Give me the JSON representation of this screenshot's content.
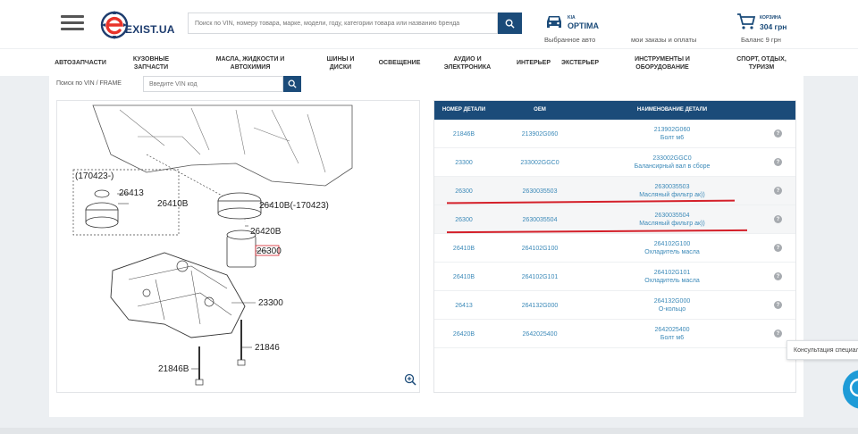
{
  "header": {
    "logo_text": "EXIST.UA",
    "search_placeholder": "Поиск по VIN, номеру товара, марке, модели, году, категории товара или названию бренда",
    "car_brand": "KIA",
    "car_model": "OPTIMA",
    "car_label": "Выбранное авто",
    "orders_label": "мои заказы и оплаты",
    "cart_title": "КОРЗИНА",
    "cart_amount": "304 грн",
    "balance": "Баланс 9 грн"
  },
  "nav": [
    {
      "label": "АВТОЗАПЧАСТИ"
    },
    {
      "label": "КУЗОВНЫЕ ЗАПЧАСТИ"
    },
    {
      "label": "МАСЛА, ЖИДКОСТИ И АВТОХИМИЯ"
    },
    {
      "label": "ШИНЫ И ДИСКИ"
    },
    {
      "label": "ОСВЕЩЕНИЕ"
    },
    {
      "label": "АУДИО И ЭЛЕКТРОНИКА"
    },
    {
      "label": "ИНТЕРЬЕР"
    },
    {
      "label": "ЭКСТЕРЬЕР"
    },
    {
      "label": "ИНСТРУМЕНТЫ И ОБОРУДОВАНИЕ"
    },
    {
      "label": "СПОРТ, ОТДЫХ, ТУРИЗМ"
    }
  ],
  "vin": {
    "label": "Поиск по VIN / FRAME",
    "placeholder": "Введите VIN код"
  },
  "diagram": {
    "labels": [
      "(170423-)",
      "26413",
      "26410B",
      "26410B(-170423)",
      "26420B",
      "26300",
      "23300",
      "21846",
      "21846B"
    ]
  },
  "table": {
    "headers": {
      "number": "НОМЕР ДЕТАЛИ",
      "oem": "OEM",
      "name": "НАИМЕНОВАНИЕ ДЕТАЛИ"
    },
    "help_glyph": "?",
    "rows": [
      {
        "number": "21846B",
        "oem": "213902G060",
        "code": "213902G060",
        "desc": "Болт м6"
      },
      {
        "number": "23300",
        "oem": "233002GGC0",
        "code": "233002GGC0",
        "desc": "Балансирный вал в сборе"
      },
      {
        "number": "26300",
        "oem": "2630035503",
        "code": "2630035503",
        "desc": "Масляный фильтр ак))"
      },
      {
        "number": "26300",
        "oem": "2630035504",
        "code": "2630035504",
        "desc": "Масляный фильтр ак))"
      },
      {
        "number": "26410B",
        "oem": "264102G100",
        "code": "264102G100",
        "desc": "Охладитель масла"
      },
      {
        "number": "26410B",
        "oem": "264102G101",
        "code": "264102G101",
        "desc": "Охладитель масла"
      },
      {
        "number": "26413",
        "oem": "264132G000",
        "code": "264132G000",
        "desc": "О-кольцо"
      },
      {
        "number": "26420B",
        "oem": "2642025400",
        "code": "2642025400",
        "desc": "Болт м6"
      }
    ]
  },
  "consult": {
    "label": "Консультация специалиста"
  },
  "colors": {
    "brand": "#1b4b79",
    "link": "#3b89b8",
    "highlight": "#d4202a",
    "chat": "#1e9bd7"
  }
}
